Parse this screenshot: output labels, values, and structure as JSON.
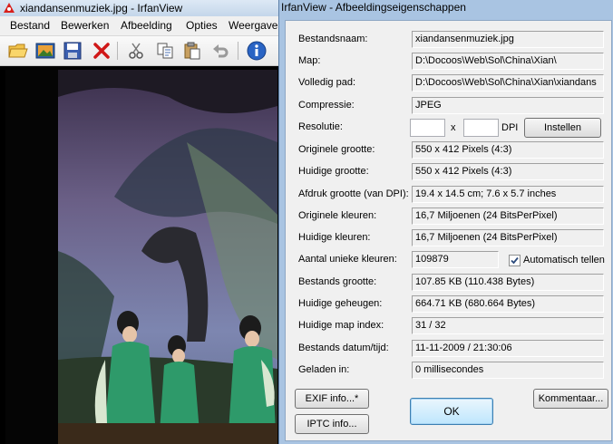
{
  "main_window": {
    "title": "xiandansenmuziek.jpg - IrfanView",
    "menu": [
      "Bestand",
      "Bewerken",
      "Afbeelding",
      "Opties",
      "Weergave"
    ],
    "toolbar_icons": [
      "open-folder-icon",
      "slideshow-icon",
      "save-icon",
      "delete-icon",
      "cut-icon",
      "copy-icon",
      "paste-icon",
      "undo-icon",
      "info-icon"
    ]
  },
  "dialog": {
    "title": "IrfanView - Afbeeldingseigenschappen",
    "fields": {
      "filename": {
        "label": "Bestandsnaam:",
        "value": "xiandansenmuziek.jpg"
      },
      "folder": {
        "label": "Map:",
        "value": "D:\\Docoos\\Web\\Sol\\China\\Xian\\"
      },
      "full_path": {
        "label": "Volledig pad:",
        "value": "D:\\Docoos\\Web\\Sol\\China\\Xian\\xiandans"
      },
      "compression": {
        "label": "Compressie:",
        "value": "JPEG"
      },
      "resolution": {
        "label": "Resolutie:",
        "x_value": "",
        "y_value": "",
        "separator": "x",
        "unit": "DPI",
        "button": "Instellen"
      },
      "original_size": {
        "label": "Originele grootte:",
        "value": "550 x 412  Pixels (4:3)"
      },
      "current_size": {
        "label": "Huidige grootte:",
        "value": "550 x 412  Pixels (4:3)"
      },
      "print_size": {
        "label": "Afdruk grootte (van DPI):",
        "value": "19.4 x 14.5 cm; 7.6 x 5.7 inches"
      },
      "original_colors": {
        "label": "Originele kleuren:",
        "value": "16,7 Miljoenen   (24 BitsPerPixel)"
      },
      "current_colors": {
        "label": "Huidige kleuren:",
        "value": "16,7 Miljoenen   (24 BitsPerPixel)"
      },
      "unique_colors": {
        "label": "Aantal unieke kleuren:",
        "value": "109879",
        "checkbox_label": "Automatisch tellen",
        "checkbox_checked": true
      },
      "file_size": {
        "label": "Bestands grootte:",
        "value": "107.85 KB (110.438 Bytes)"
      },
      "memory": {
        "label": "Huidige geheugen:",
        "value": "664.71  KB (680.664 Bytes)"
      },
      "folder_index": {
        "label": "Huidige map index:",
        "value": "31  /  32"
      },
      "file_datetime": {
        "label": "Bestands datum/tijd:",
        "value": "11-11-2009 / 21:30:06"
      },
      "loaded_in": {
        "label": "Geladen in:",
        "value": "0 millisecondes"
      }
    },
    "buttons": {
      "exif": "EXIF info...*",
      "iptc": "IPTC info...",
      "ok": "OK",
      "comment": "Kommentaar..."
    }
  }
}
